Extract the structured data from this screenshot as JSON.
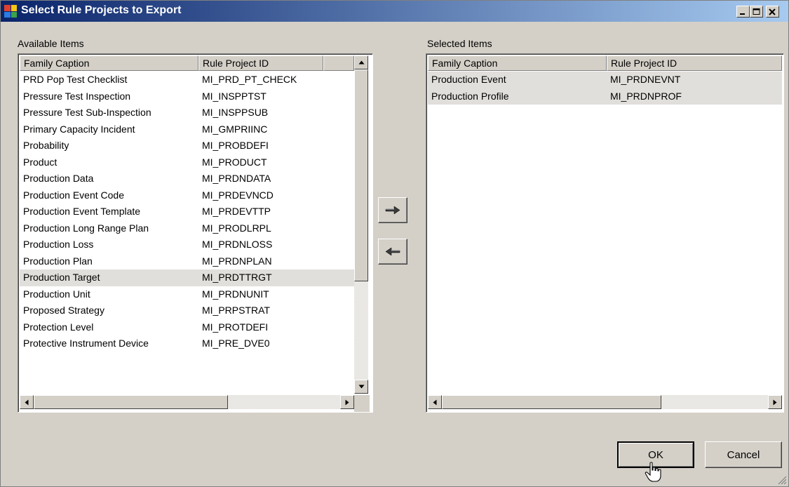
{
  "window": {
    "title": "Select Rule Projects to Export"
  },
  "available": {
    "label": "Available Items",
    "headers": [
      "Family Caption",
      "Rule Project ID"
    ],
    "rows": [
      {
        "caption": "PRD Pop Test Checklist",
        "id": "MI_PRD_PT_CHECK"
      },
      {
        "caption": "Pressure Test Inspection",
        "id": "MI_INSPPTST"
      },
      {
        "caption": "Pressure Test Sub-Inspection",
        "id": "MI_INSPPSUB"
      },
      {
        "caption": "Primary Capacity Incident",
        "id": "MI_GMPRIINC"
      },
      {
        "caption": "Probability",
        "id": "MI_PROBDEFI"
      },
      {
        "caption": "Product",
        "id": "MI_PRODUCT"
      },
      {
        "caption": "Production Data",
        "id": "MI_PRDNDATA"
      },
      {
        "caption": "Production Event Code",
        "id": "MI_PRDEVNCD"
      },
      {
        "caption": "Production Event Template",
        "id": "MI_PRDEVTTP"
      },
      {
        "caption": "Production Long Range Plan",
        "id": "MI_PRODLRPL"
      },
      {
        "caption": "Production Loss",
        "id": "MI_PRDNLOSS"
      },
      {
        "caption": "Production Plan",
        "id": "MI_PRDNPLAN"
      },
      {
        "caption": "Production Target",
        "id": "MI_PRDTTRGT"
      },
      {
        "caption": "Production Unit",
        "id": "MI_PRDNUNIT"
      },
      {
        "caption": "Proposed Strategy",
        "id": "MI_PRPSTRAT"
      },
      {
        "caption": "Protection Level",
        "id": "MI_PROTDEFI"
      },
      {
        "caption": "Protective Instrument Device",
        "id": "MI_PRE_DVE0"
      }
    ],
    "selected_index": 12
  },
  "selected": {
    "label": "Selected Items",
    "headers": [
      "Family Caption",
      "Rule Project ID"
    ],
    "rows": [
      {
        "caption": "Production Event",
        "id": "MI_PRDNEVNT"
      },
      {
        "caption": "Production Profile",
        "id": "MI_PRDNPROF"
      }
    ]
  },
  "buttons": {
    "ok": "OK",
    "cancel": "Cancel"
  },
  "icons": {
    "add": "arrow-right-icon",
    "remove": "arrow-left-icon",
    "minimize": "minimize-icon",
    "maximize": "maximize-icon",
    "close": "close-icon"
  },
  "colors": {
    "title_start": "#0a246a",
    "title_end": "#a6caf0",
    "dialog": "#d4d0c8",
    "row_highlight": "#e1dfdb"
  }
}
